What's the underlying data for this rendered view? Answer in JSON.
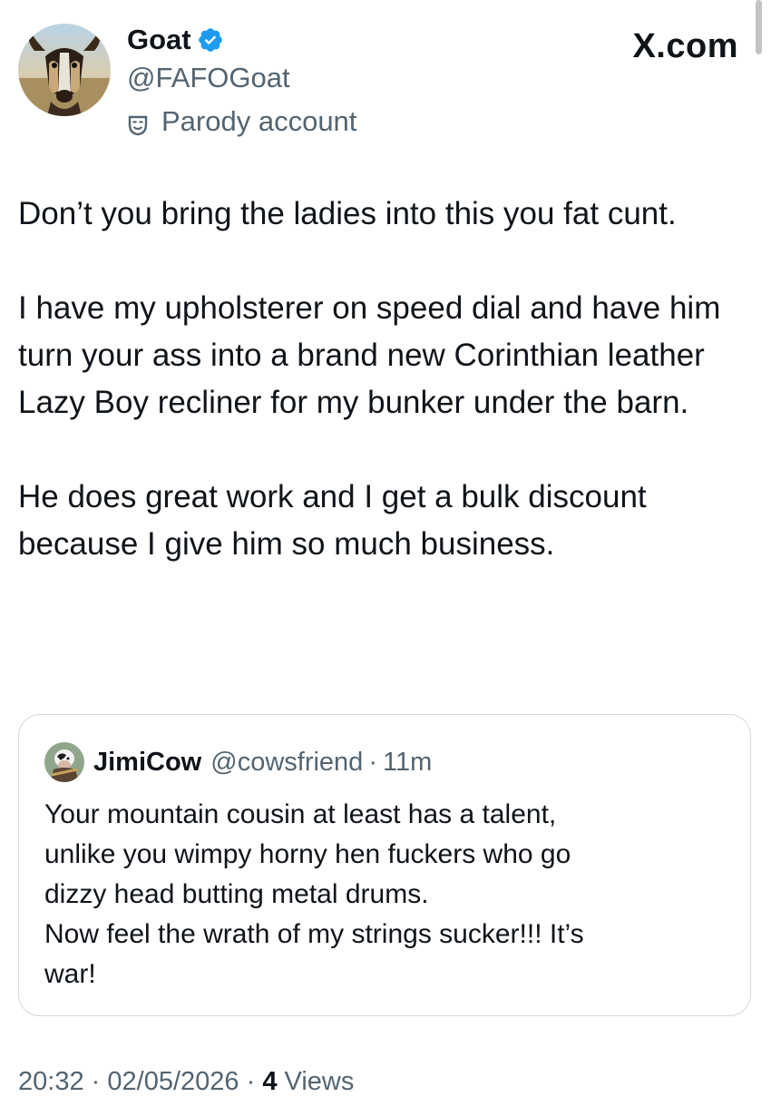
{
  "tweet": {
    "author": {
      "name": "Goat",
      "handle": "@FAFOGoat",
      "label": "Parody account",
      "verified": true,
      "avatar_icon": "goat-avatar"
    },
    "site": "X.com",
    "paragraphs": [
      "Don’t you bring the ladies into this you fat cunt.",
      "I have my upholsterer on speed dial and have him turn your ass into a brand new Corinthian leather Lazy Boy recliner for my bunker under the barn.",
      "He does great work and I get a bulk discount because I give him so much business."
    ],
    "quote": {
      "name": "JimiCow",
      "handle": "@cowsfriend",
      "separator": "·",
      "time": "11m",
      "avatar_icon": "cow-avatar",
      "lines": [
        "Your mountain cousin at least has a talent,",
        "unlike you wimpy horny hen fuckers who go",
        "dizzy head butting metal drums.",
        "Now feel the wrath of my strings sucker!!! It’s",
        "war!"
      ]
    },
    "meta": {
      "time": "20:32",
      "separator": "·",
      "date": "02/05/2026",
      "views_count": "4",
      "views_label": "Views"
    }
  },
  "colors": {
    "text": "#0f1419",
    "secondary": "#536471",
    "verified": "#1d9bf0",
    "border": "#cfd9de"
  }
}
